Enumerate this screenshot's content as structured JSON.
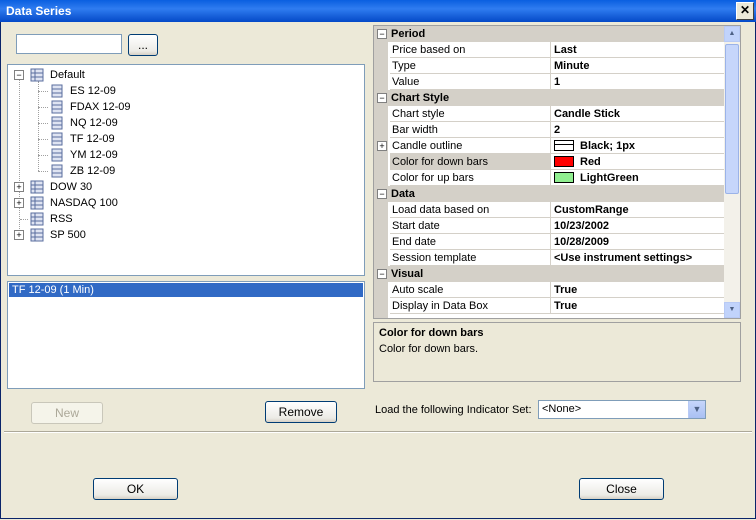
{
  "window": {
    "title": "Data Series",
    "close_glyph": "✕"
  },
  "search": {
    "value": "",
    "browse_label": "..."
  },
  "tree": [
    {
      "label": "Default",
      "expanded": true,
      "children": [
        "ES 12-09",
        "FDAX 12-09",
        "NQ 12-09",
        "TF 12-09",
        "YM 12-09",
        "ZB 12-09"
      ]
    },
    {
      "label": "DOW 30",
      "expanded": false
    },
    {
      "label": "NASDAQ 100",
      "expanded": false
    },
    {
      "label": "RSS",
      "expanded": null
    },
    {
      "label": "SP 500",
      "expanded": false
    }
  ],
  "series_list": {
    "items": [
      "TF 12-09 (1 Min)"
    ]
  },
  "buttons": {
    "new": "New",
    "remove": "Remove",
    "ok": "OK",
    "close": "Close"
  },
  "properties": {
    "period": {
      "label": "Period",
      "rows": [
        {
          "name": "Price based on",
          "value": "Last"
        },
        {
          "name": "Type",
          "value": "Minute"
        },
        {
          "name": "Value",
          "value": "1"
        }
      ]
    },
    "chart_style": {
      "label": "Chart Style",
      "rows": [
        {
          "name": "Chart style",
          "value": "Candle Stick"
        },
        {
          "name": "Bar width",
          "value": "2"
        },
        {
          "name": "Candle outline",
          "value": "Black; 1px"
        },
        {
          "name": "Color for down bars",
          "value": "Red"
        },
        {
          "name": "Color for up bars",
          "value": "LightGreen"
        }
      ]
    },
    "data": {
      "label": "Data",
      "rows": [
        {
          "name": "Load data based on",
          "value": "CustomRange"
        },
        {
          "name": "Start date",
          "value": "10/23/2002"
        },
        {
          "name": "End date",
          "value": "10/28/2009"
        },
        {
          "name": "Session template",
          "value": "<Use instrument settings>"
        }
      ]
    },
    "visual": {
      "label": "Visual",
      "rows": [
        {
          "name": "Auto scale",
          "value": "True"
        },
        {
          "name": "Display in Data Box",
          "value": "True"
        }
      ]
    }
  },
  "colors": {
    "down_bars": "#ff0000",
    "up_bars": "#90ee90",
    "outline": "#000000",
    "selection": "#316ac5"
  },
  "description": {
    "title": "Color for down bars",
    "text": "Color for down bars."
  },
  "indicator_set": {
    "label": "Load the following Indicator Set:",
    "selected": "<None>"
  }
}
